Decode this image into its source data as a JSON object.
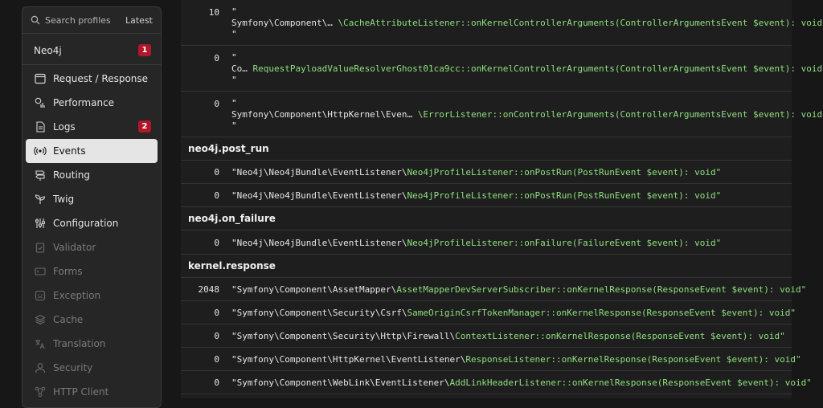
{
  "sidebar": {
    "search_placeholder": "Search profiles",
    "latest": "Latest",
    "items": [
      {
        "label": "Neo4j",
        "icon": "none",
        "badge": "1",
        "state": "normal"
      },
      {
        "label": "Request / Response",
        "icon": "window-icon",
        "badge": "",
        "state": "normal"
      },
      {
        "label": "Performance",
        "icon": "stopwatch-icon",
        "badge": "",
        "state": "normal"
      },
      {
        "label": "Logs",
        "icon": "log-file-icon",
        "badge": "2",
        "state": "normal"
      },
      {
        "label": "Events",
        "icon": "broadcast-icon",
        "badge": "",
        "state": "active"
      },
      {
        "label": "Routing",
        "icon": "signpost-icon",
        "badge": "",
        "state": "normal"
      },
      {
        "label": "Twig",
        "icon": "sprout-icon",
        "badge": "",
        "state": "normal"
      },
      {
        "label": "Configuration",
        "icon": "sliders-icon",
        "badge": "",
        "state": "normal"
      },
      {
        "label": "Validator",
        "icon": "clipboard-check-icon",
        "badge": "",
        "state": "disabled"
      },
      {
        "label": "Forms",
        "icon": "form-icon",
        "badge": "",
        "state": "disabled"
      },
      {
        "label": "Exception",
        "icon": "error-face-icon",
        "badge": "",
        "state": "disabled"
      },
      {
        "label": "Cache",
        "icon": "stack-icon",
        "badge": "",
        "state": "disabled"
      },
      {
        "label": "Translation",
        "icon": "translate-icon",
        "badge": "",
        "state": "disabled"
      },
      {
        "label": "Security",
        "icon": "user-icon",
        "badge": "",
        "state": "disabled"
      },
      {
        "label": "HTTP Client",
        "icon": "network-icon",
        "badge": "",
        "state": "disabled"
      }
    ]
  },
  "top_rows": [
    {
      "priority": "10",
      "ns": "Symfony\\Component\\…",
      "method": "\\CacheAttributeListener::onKernelControllerArguments(ControllerArgumentsEvent $event): void"
    },
    {
      "priority": "0",
      "ns": "Co…",
      "method": "RequestPayloadValueResolverGhost01ca9cc::onKernelControllerArguments(ControllerArgumentsEvent $event): void"
    },
    {
      "priority": "0",
      "ns": "Symfony\\Component\\HttpKernel\\Even…",
      "method": "\\ErrorListener::onControllerArguments(ControllerArgumentsEvent $event): void"
    }
  ],
  "groups": [
    {
      "name": "neo4j.post_run",
      "rows": [
        {
          "priority": "0",
          "cls": "\"Neo4j\\Neo4jBundle\\EventListener\\",
          "method": "Neo4jProfileListener::onPostRun(PostRunEvent $event): void\""
        },
        {
          "priority": "0",
          "cls": "\"Neo4j\\Neo4jBundle\\EventListener\\",
          "method": "Neo4jProfileListener::onPostRun(PostRunEvent $event): void\""
        }
      ]
    },
    {
      "name": "neo4j.on_failure",
      "rows": [
        {
          "priority": "0",
          "cls": "\"Neo4j\\Neo4jBundle\\EventListener\\",
          "method": "Neo4jProfileListener::onFailure(FailureEvent $event): void\""
        }
      ]
    },
    {
      "name": "kernel.response",
      "rows": [
        {
          "priority": "2048",
          "cls": "\"Symfony\\Component\\AssetMapper\\",
          "method": "AssetMapperDevServerSubscriber::onKernelResponse(ResponseEvent $event): void\""
        },
        {
          "priority": "0",
          "cls": "\"Symfony\\Component\\Security\\Csrf\\",
          "method": "SameOriginCsrfTokenManager::onKernelResponse(ResponseEvent $event): void\""
        },
        {
          "priority": "0",
          "cls": "\"Symfony\\Component\\Security\\Http\\Firewall\\",
          "method": "ContextListener::onKernelResponse(ResponseEvent $event): void\""
        },
        {
          "priority": "0",
          "cls": "\"Symfony\\Component\\HttpKernel\\EventListener\\",
          "method": "ResponseListener::onKernelResponse(ResponseEvent $event): void\""
        },
        {
          "priority": "0",
          "cls": "\"Symfony\\Component\\WebLink\\EventListener\\",
          "method": "AddLinkHeaderListener::onKernelResponse(ResponseEvent $event): void\""
        }
      ]
    }
  ]
}
